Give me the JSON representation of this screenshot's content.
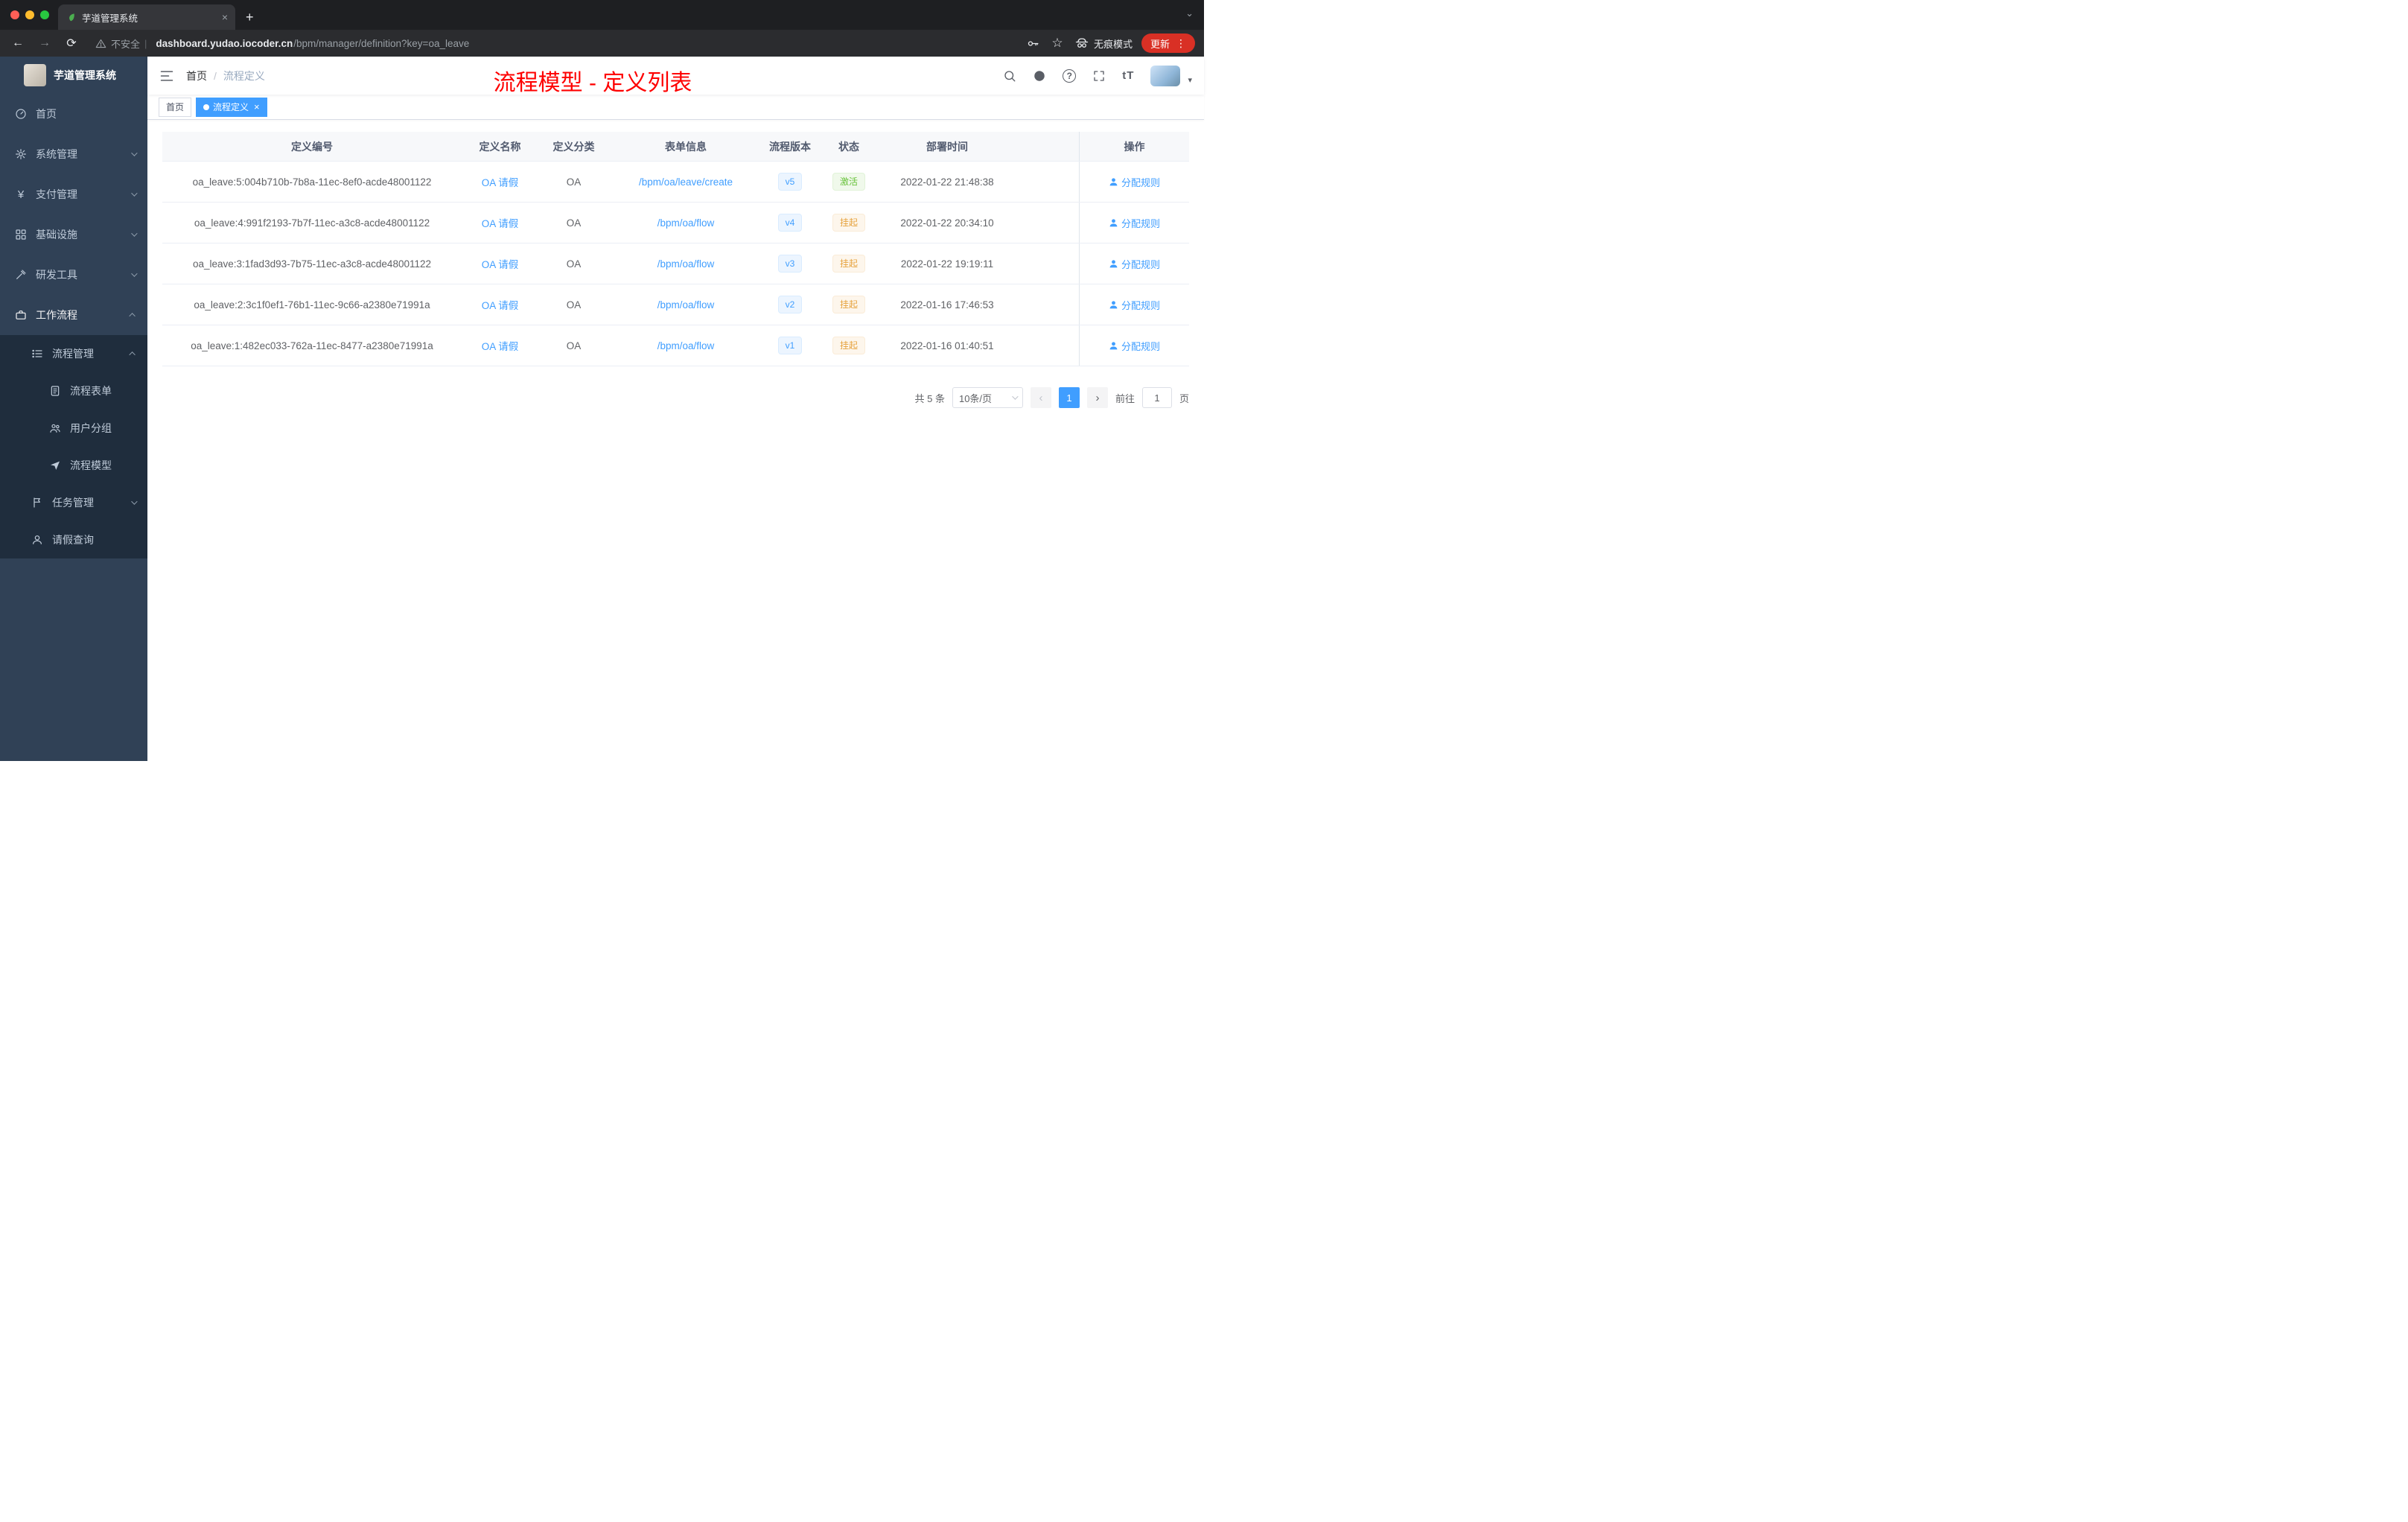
{
  "glyphs": {
    "back": "←",
    "forward": "→",
    "reload": "⟳",
    "star": "☆",
    "menu_dots": "⋮",
    "new_tab": "+",
    "tab_caret": "⌄",
    "close": "×",
    "question": "?",
    "font_size": "tT",
    "yen": "¥",
    "prev": "‹",
    "next": "›",
    "avatar_caret": "▾",
    "breadcrumb_sep": "/",
    "url_divider": "|",
    "tag_close": "×"
  },
  "browser": {
    "tab_title": "芋道管理系统",
    "security_label": "不安全",
    "url_host": "dashboard.yudao.iocoder.cn",
    "url_path": "/bpm/manager/definition?key=oa_leave",
    "incognito_label": "无痕模式",
    "update_label": "更新"
  },
  "sidebar": {
    "logo_title": "芋道管理系统",
    "items": [
      {
        "label": "首页",
        "icon": "gauge-icon"
      },
      {
        "label": "系统管理",
        "icon": "gear-icon"
      },
      {
        "label": "支付管理",
        "icon": "yen-icon"
      },
      {
        "label": "基础设施",
        "icon": "grid-icon"
      },
      {
        "label": "研发工具",
        "icon": "tools-icon"
      },
      {
        "label": "工作流程",
        "icon": "briefcase-icon"
      },
      {
        "label": "流程管理",
        "icon": "list-icon"
      },
      {
        "label": "流程表单",
        "icon": "form-icon"
      },
      {
        "label": "用户分组",
        "icon": "users-icon"
      },
      {
        "label": "流程模型",
        "icon": "send-icon"
      },
      {
        "label": "任务管理",
        "icon": "flag-icon"
      },
      {
        "label": "请假查询",
        "icon": "user-icon"
      }
    ]
  },
  "header": {
    "breadcrumb_home": "首页",
    "breadcrumb_current": "流程定义",
    "page_title": "流程模型 - 定义列表"
  },
  "tags": {
    "items": [
      {
        "label": "首页"
      },
      {
        "label": "流程定义"
      }
    ]
  },
  "table": {
    "columns": {
      "id": "定义编号",
      "name": "定义名称",
      "category": "定义分类",
      "form": "表单信息",
      "version": "流程版本",
      "status": "状态",
      "deploy_time": "部署时间",
      "action": "操作"
    },
    "rows": [
      {
        "id": "oa_leave:5:004b710b-7b8a-11ec-8ef0-acde48001122",
        "name": "OA 请假",
        "category": "OA",
        "form": "/bpm/oa/leave/create",
        "version": "v5",
        "status": "激活",
        "deploy_time": "2022-01-22 21:48:38",
        "action": "分配规则"
      },
      {
        "id": "oa_leave:4:991f2193-7b7f-11ec-a3c8-acde48001122",
        "name": "OA 请假",
        "category": "OA",
        "form": "/bpm/oa/flow",
        "version": "v4",
        "status": "挂起",
        "deploy_time": "2022-01-22 20:34:10",
        "action": "分配规则"
      },
      {
        "id": "oa_leave:3:1fad3d93-7b75-11ec-a3c8-acde48001122",
        "name": "OA 请假",
        "category": "OA",
        "form": "/bpm/oa/flow",
        "version": "v3",
        "status": "挂起",
        "deploy_time": "2022-01-22 19:19:11",
        "action": "分配规则"
      },
      {
        "id": "oa_leave:2:3c1f0ef1-76b1-11ec-9c66-a2380e71991a",
        "name": "OA 请假",
        "category": "OA",
        "form": "/bpm/oa/flow",
        "version": "v2",
        "status": "挂起",
        "deploy_time": "2022-01-16 17:46:53",
        "action": "分配规则"
      },
      {
        "id": "oa_leave:1:482ec033-762a-11ec-8477-a2380e71991a",
        "name": "OA 请假",
        "category": "OA",
        "form": "/bpm/oa/flow",
        "version": "v1",
        "status": "挂起",
        "deploy_time": "2022-01-16 01:40:51",
        "action": "分配规则"
      }
    ]
  },
  "pagination": {
    "total": "共 5 条",
    "page_size": "10条/页",
    "page": "1",
    "goto": "前往",
    "goto_value": "1",
    "unit": "页"
  },
  "colors": {
    "accent": "#409eff",
    "success": "#67c23a",
    "warning": "#e6a23c",
    "title_red": "#fe0000",
    "sidebar_bg": "#304156",
    "submenu_bg": "#1f2d3d"
  }
}
